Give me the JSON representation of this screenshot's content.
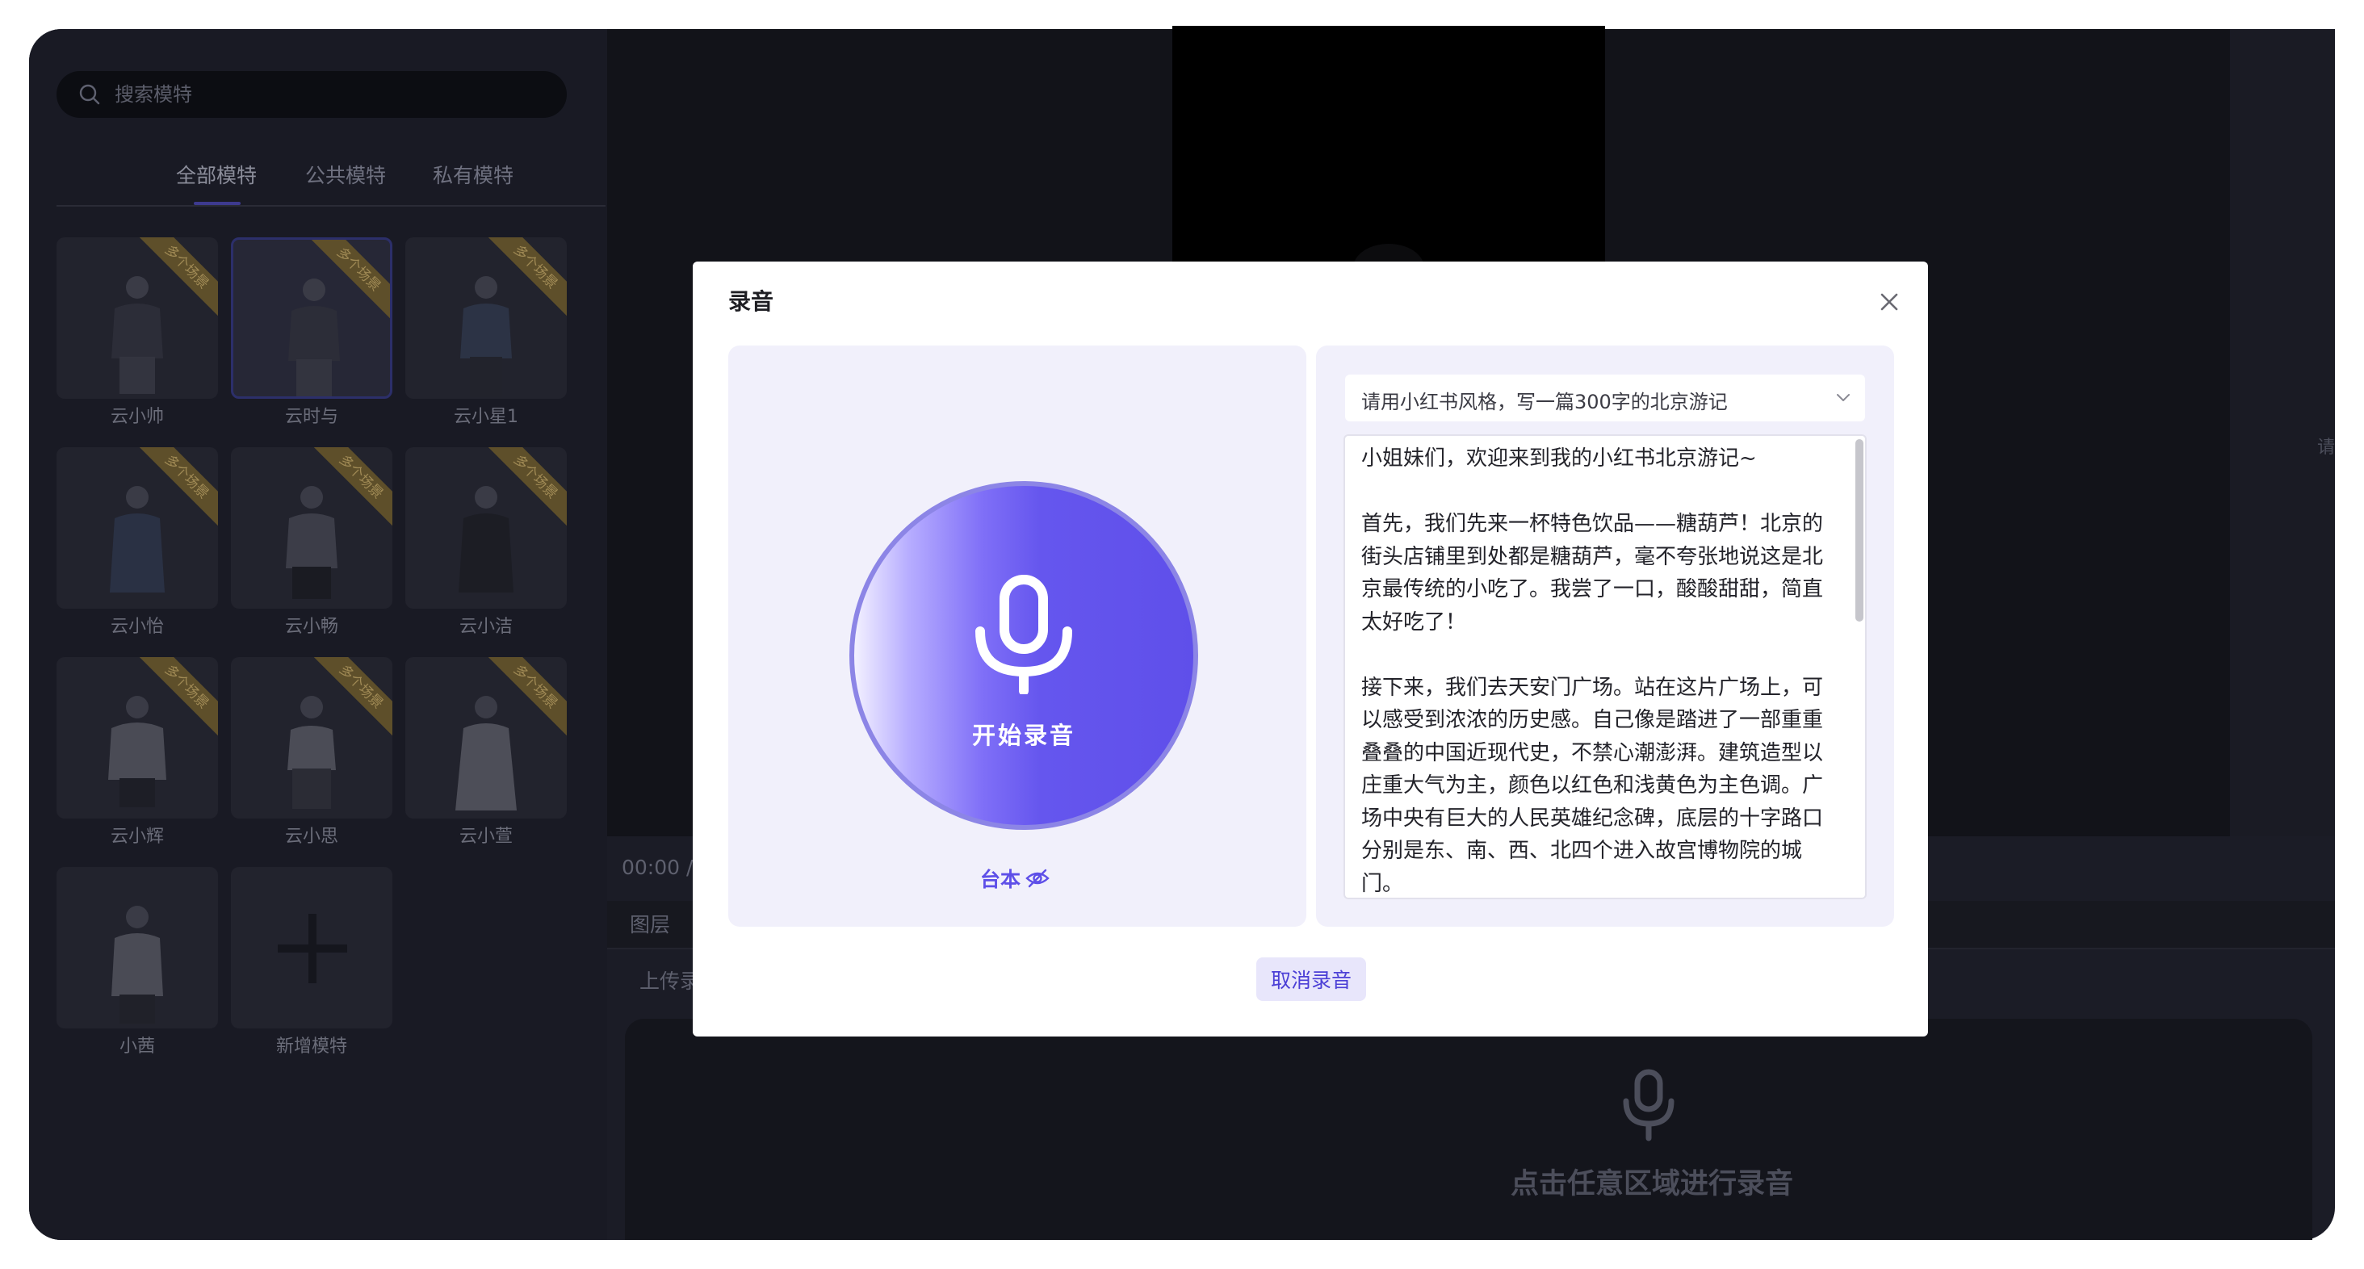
{
  "sidebar": {
    "search_placeholder": "搜索模特",
    "tabs": [
      {
        "label": "全部模特",
        "active": true
      },
      {
        "label": "公共模特",
        "active": false
      },
      {
        "label": "私有模特",
        "active": false
      }
    ],
    "models": [
      {
        "name": "云小帅",
        "badge": "多个场景"
      },
      {
        "name": "云时与",
        "badge": "多个场景",
        "selected": true
      },
      {
        "name": "云小星1",
        "badge": "多个场景"
      },
      {
        "name": "云小怡",
        "badge": "多个场景"
      },
      {
        "name": "云小畅",
        "badge": "多个场景"
      },
      {
        "name": "云小洁",
        "badge": "多个场景"
      },
      {
        "name": "云小辉",
        "badge": "多个场景"
      },
      {
        "name": "云小思",
        "badge": "多个场景"
      },
      {
        "name": "云小萱",
        "badge": "多个场景"
      },
      {
        "name": "小茜",
        "badge": ""
      }
    ],
    "add_model_label": "新增模特"
  },
  "editor": {
    "time": "00:00 /",
    "layers_label": "图层",
    "upload_label": "上传录",
    "right_hint": "请",
    "record_area_hint": "点击任意区域进行录音"
  },
  "modal": {
    "title": "录音",
    "start_label": "开始录音",
    "script_toggle_label": "台本",
    "prompt": "请用小红书风格，写一篇300字的北京游记",
    "script": "小姐妹们，欢迎来到我的小红书北京游记~\n\n首先，我们先来一杯特色饮品——糖葫芦！北京的街头店铺里到处都是糖葫芦，毫不夸张地说这是北京最传统的小吃了。我尝了一口，酸酸甜甜，简直太好吃了！\n\n接下来，我们去天安门广场。站在这片广场上，可以感受到浓浓的历史感。自己像是踏进了一部重重叠叠的中国近现代史，不禁心潮澎湃。建筑造型以庄重大气为主，颜色以红色和浅黄色为主色调。广场中央有巨大的人民英雄纪念碑，底层的十字路口分别是东、南、西、北四个进入故宫博物院的城门。",
    "cancel_label": "取消录音"
  },
  "colors": {
    "accent": "#5e4fe8",
    "modal_pane": "#f1f0fb",
    "app_bg": "#1b1c26"
  }
}
